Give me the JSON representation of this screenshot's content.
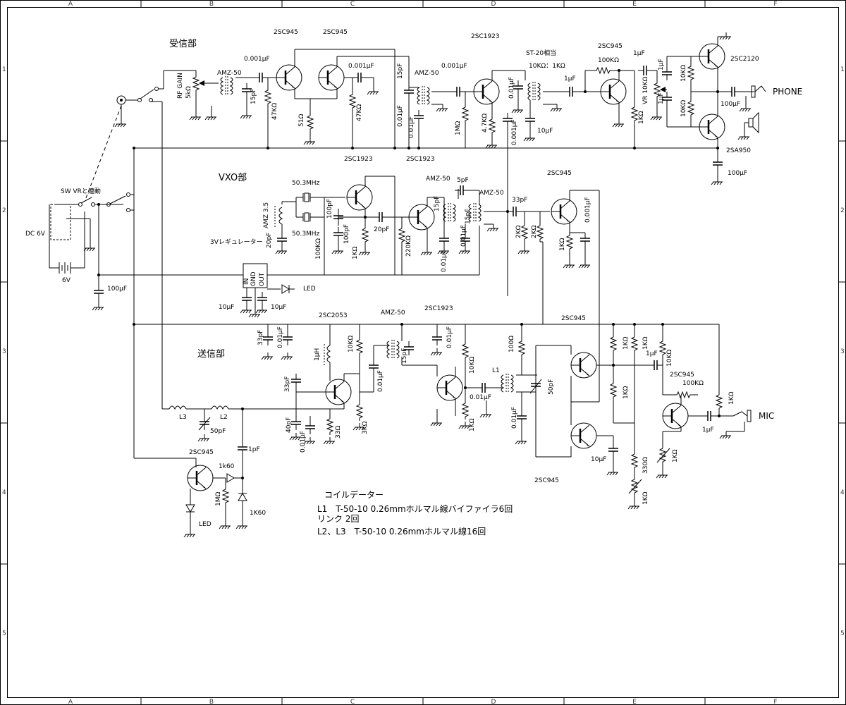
{
  "sections": {
    "receiver": "受信部",
    "vxo": "VXO部",
    "transmitter": "送信部"
  },
  "border": {
    "columns": [
      "A",
      "B",
      "C",
      "D",
      "E",
      "F"
    ],
    "rows": [
      "1",
      "2",
      "3",
      "4",
      "5"
    ]
  },
  "transistors": {
    "rx_q1": "2SC945",
    "rx_q2": "2SC945",
    "rx_if": "2SC1923",
    "rx_af": "2SC945",
    "out_top": "2SC2120",
    "out_bot": "2SA950",
    "rx_lbl_a": "2SC1923",
    "rx_lbl_b": "2SC1923",
    "vxo_mix": "2SC945",
    "tx_q1": "2SC2053",
    "tx_q2": "2SC1923",
    "tx_bal_top": "2SC945",
    "tx_bal_bot": "2SC945",
    "tx_mic": "2SC945",
    "tx_led": "2SC945"
  },
  "labels": {
    "c_001_a": "0.001μF",
    "c_001_b": "0.001μF",
    "c_001_c": "0.001μF",
    "c_001_d": "0.001μF",
    "c_001_e": "0.001μF",
    "amz_rx1": "AMZ-50",
    "amz_rx2": "AMZ-50",
    "amz_vxo1": "AMZ-50",
    "amz_vxo2": "AMZ-50",
    "amz_tx": "AMZ-50",
    "rf_gain": "RF GAIN",
    "rf_gain_val": "5kΩ",
    "c15p_a": "15pF",
    "c15p_b": "15pF",
    "c15p_c": "15pF",
    "c15p_d": "15pF",
    "c15p_e": "15pF",
    "r47k_a": "47KΩ",
    "r47k_b": "47KΩ",
    "r47k_c": "4.7KΩ",
    "r51": "51Ω",
    "c001_rx1": "0.01μF",
    "c001_rx2": "0.01μF",
    "c001_rx3": "0.01μF",
    "c001_rx4": "0.01μF",
    "r1m": "1MΩ",
    "st20": "ST-20相当",
    "ratio": "10KΩ：1KΩ",
    "c1u_a": "1μF",
    "c1u_b": "1μF",
    "c1u_c": "1μF",
    "c1u_d": "1μF",
    "c1u_e": "1μF",
    "c1u_f": "1μF",
    "r100k_a": "100KΩ",
    "r100k_b": "100KΩ",
    "vr10k": "VR 10KΩ",
    "r10k_a": "10KΩ",
    "r10k_b": "10KΩ",
    "r1k_a": "1KΩ",
    "c10u_a": "10μF",
    "c100u_a": "100μF",
    "c100u_b": "100μF",
    "c100u_c": "100μF",
    "phone": "PHONE",
    "sw_vr": "SW VRと連動",
    "dc6v": "DC 6V",
    "bat6v": "6V",
    "x1": "50.3MHz",
    "x2": "50.3MHz",
    "amz35": "AMZ 3.5",
    "c20p_a": "20pF",
    "c20p_b": "20pF",
    "c100p_a": "100pF",
    "c100p_b": "100pF",
    "r100k_c": "100KΩ",
    "r1k_b": "1KΩ",
    "r220k": "220KΩ",
    "c5p": "5pF",
    "c33p_a": "33pF",
    "r2k_a": "2KΩ",
    "r2k_b": "2KΩ",
    "r1k_c": "1KΩ",
    "reg": "3Vレギュレーター",
    "reg_in": "IN",
    "reg_gnd": "GND",
    "reg_out": "OUT",
    "c10u_b": "10μF",
    "c10u_c": "10μF",
    "led_a": "LED",
    "led_b": "LED",
    "c33p_b": "33pF",
    "c33p_c": "33pF",
    "c001_tx1": "0.01μF",
    "c001_tx2": "0.01μF",
    "c001_tx3": "0.01μF",
    "c001_tx4": "0.01μF",
    "c001_tx5": "0.01μF",
    "c001_tx6": "0.01μF",
    "l1uh": "1μH",
    "r10k_c": "10KΩ",
    "r10k_d": "10KΩ",
    "r1k_d": "1KΩ",
    "r33": "33Ω",
    "r3k": "3KΩ",
    "c40p": "40pF",
    "r100": "100Ω",
    "l1": "L1",
    "c50p_a": "50pF",
    "c50p_b": "50pF",
    "r1k_e": "1KΩ",
    "r1k_f": "1KΩ",
    "r1k_g": "1KΩ",
    "r1k_h": "1KΩ",
    "r1k_i": "1KΩ",
    "r1k_j": "1KΩ",
    "r330": "330Ω",
    "c10u_d": "10μF",
    "mic": "MIC",
    "l3": "L3",
    "l2": "L2",
    "c1p": "1pF",
    "d1k60_a": "1k60",
    "d1k60_b": "1K60",
    "r1m_b": "1MΩ"
  },
  "coil_notes": {
    "title": "コイルデーター",
    "line1": "L1　T-50-10 0.26mmホルマル線バイファイラ6回",
    "line2": "リンク 2回",
    "line3": "L2、L3　T-50-10 0.26mmホルマル線16回"
  }
}
